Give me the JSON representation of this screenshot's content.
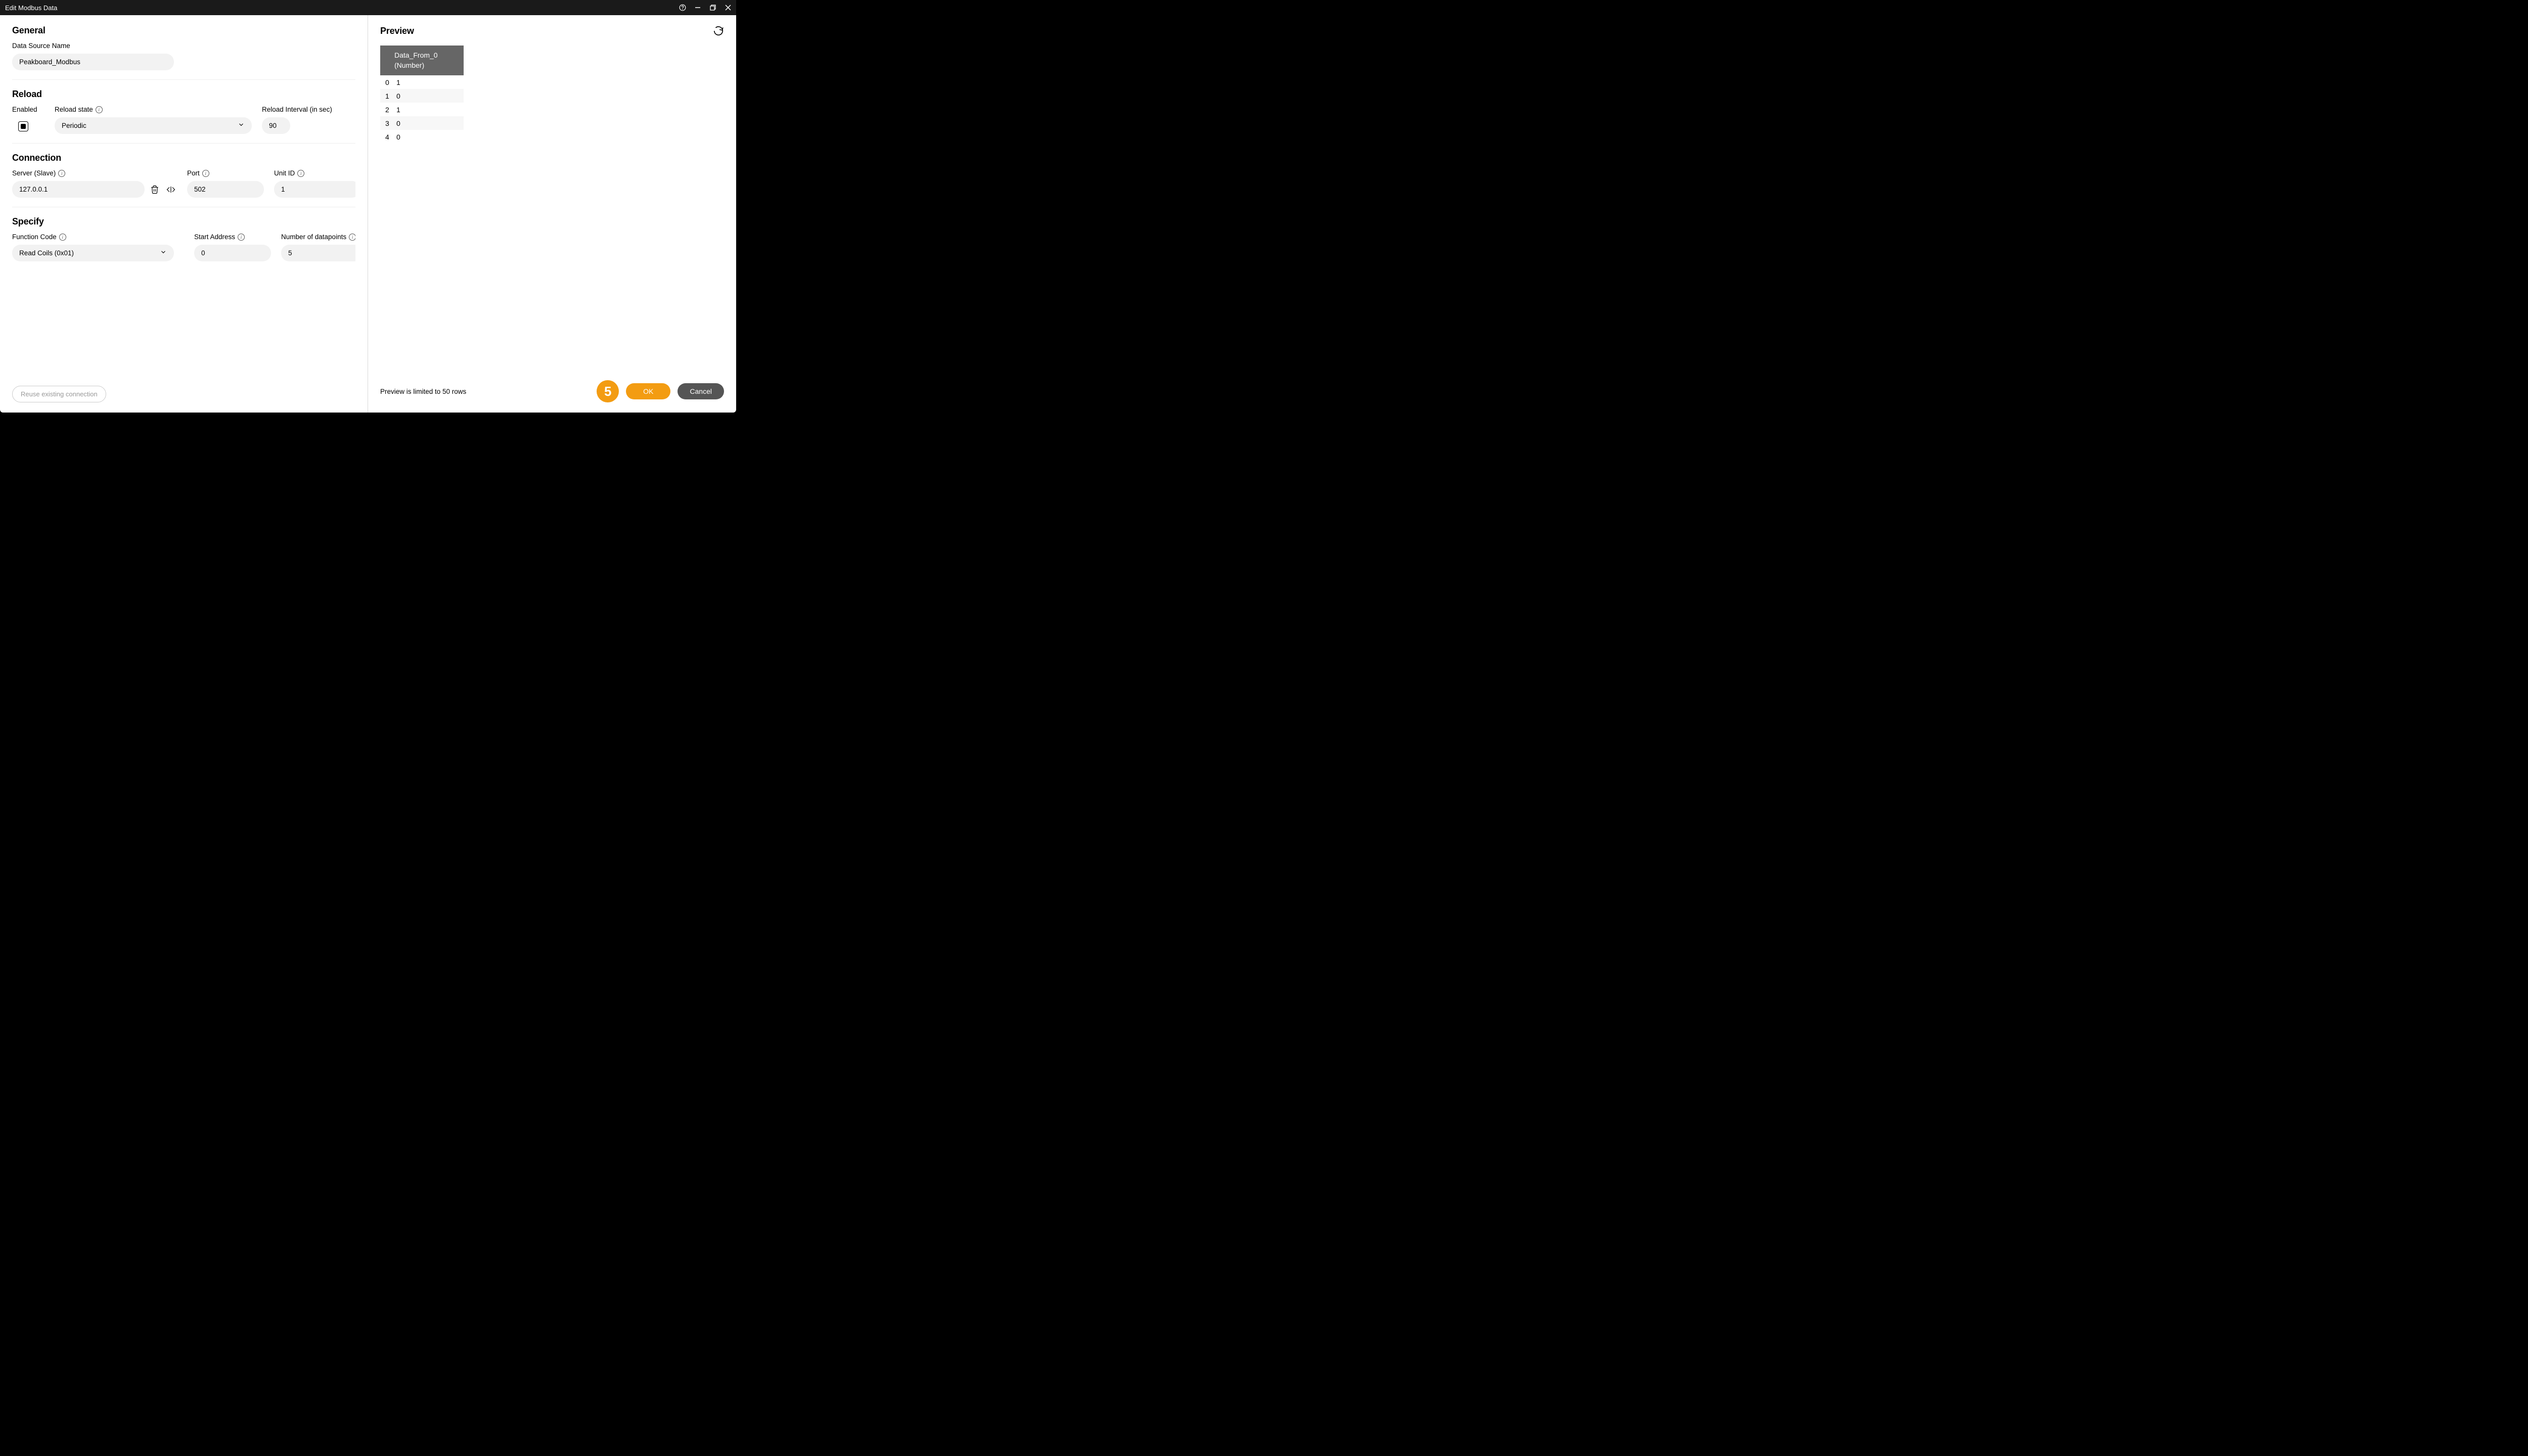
{
  "window": {
    "title": "Edit Modbus Data"
  },
  "general": {
    "heading": "General",
    "dsn_label": "Data Source Name",
    "dsn_value": "Peakboard_Modbus"
  },
  "reload": {
    "heading": "Reload",
    "enabled_label": "Enabled",
    "state_label": "Reload state",
    "state_value": "Periodic",
    "interval_label": "Reload Interval (in sec)",
    "interval_value": "90"
  },
  "connection": {
    "heading": "Connection",
    "server_label": "Server (Slave)",
    "server_value": "127.0.0.1",
    "port_label": "Port",
    "port_value": "502",
    "unit_label": "Unit ID",
    "unit_value": "1"
  },
  "specify": {
    "heading": "Specify",
    "fc_label": "Function Code",
    "fc_value": "Read Coils (0x01)",
    "start_label": "Start Address",
    "start_value": "0",
    "num_label": "Number of datapoints",
    "num_value": "5"
  },
  "preview": {
    "heading": "Preview",
    "column_name": "Data_From_0",
    "column_type": "(Number)",
    "rows": [
      {
        "idx": "0",
        "val": "1"
      },
      {
        "idx": "1",
        "val": "0"
      },
      {
        "idx": "2",
        "val": "1"
      },
      {
        "idx": "3",
        "val": "0"
      },
      {
        "idx": "4",
        "val": "0"
      }
    ],
    "limit_text": "Preview is limited to 50 rows"
  },
  "footer": {
    "reuse_label": "Reuse existing connection",
    "ok_label": "OK",
    "cancel_label": "Cancel",
    "step_badge": "5"
  }
}
